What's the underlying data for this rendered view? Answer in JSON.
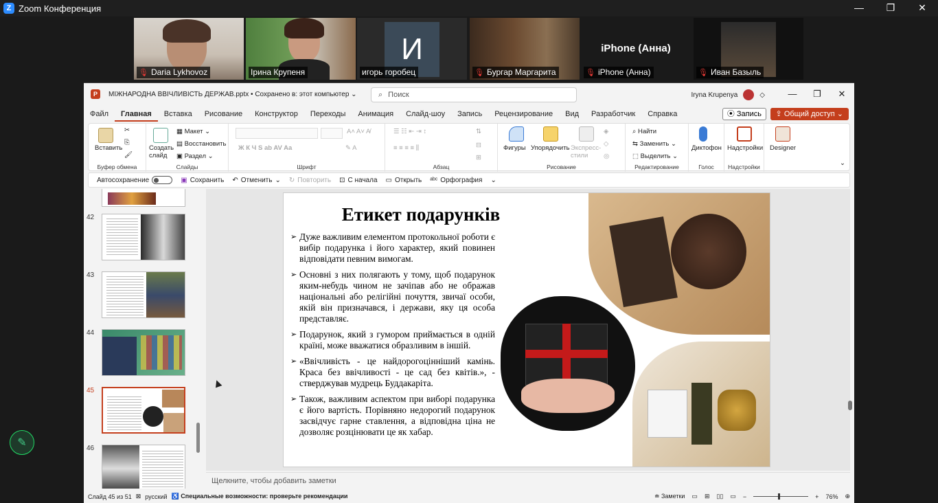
{
  "zoom": {
    "title": "Zoom Конференция",
    "window_buttons": [
      "—",
      "❐",
      "✕"
    ]
  },
  "participants": [
    {
      "name": "Daria Lykhovoz",
      "muted": true
    },
    {
      "name": "Ірина Крупеня",
      "muted": false,
      "active": true
    },
    {
      "name": "игорь горобец",
      "muted": false,
      "initial": "И"
    },
    {
      "name": "Бургар Маргарита",
      "muted": true
    },
    {
      "name": "iPhone (Анна)",
      "muted": true,
      "big_label": "iPhone (Анна)"
    },
    {
      "name": "Иван Базыль",
      "muted": true
    }
  ],
  "ppt": {
    "filename": "МІЖНАРОДНА ВВІЧЛИВІСТЬ ДЕРЖАВ.pptx • Сохранено в: этот компьютер ⌄",
    "search_placeholder": "Поиск",
    "user": "Iryna Krupenya",
    "menu": [
      "Файл",
      "Главная",
      "Вставка",
      "Рисование",
      "Конструктор",
      "Переходы",
      "Анимация",
      "Слайд-шоу",
      "Запись",
      "Рецензирование",
      "Вид",
      "Разработчик",
      "Справка"
    ],
    "record_label": "Запись",
    "share_label": "Общий доступ",
    "ribbon": {
      "clipboard": {
        "paste": "Вставить",
        "label": "Буфер обмена"
      },
      "slides": {
        "create": "Создать слайд",
        "layout": "Макет",
        "reset": "Восстановить",
        "section": "Раздел",
        "label": "Слайды"
      },
      "font": {
        "label": "Шрифт"
      },
      "paragraph": {
        "label": "Абзац"
      },
      "drawing": {
        "shapes": "Фигуры",
        "arrange": "Упорядочить",
        "quick_styles": "Экспресс-стили",
        "label": "Рисование"
      },
      "editing": {
        "find": "Найти",
        "replace": "Заменить",
        "select": "Выделить",
        "label": "Редактирование"
      },
      "voice": {
        "dictate": "Диктофон",
        "label": "Голос"
      },
      "addins": {
        "addins": "Надстройки",
        "label": "Надстройки"
      },
      "designer": "Designer"
    },
    "qat": {
      "autosave": "Автосохранение",
      "save": "Сохранить",
      "undo": "Отменить",
      "redo": "Повторить",
      "from_start": "С начала",
      "open": "Открыть",
      "spelling": "Орфография"
    },
    "thumbs": [
      "42",
      "43",
      "44",
      "45",
      "46"
    ],
    "selected_thumb": "45",
    "slide": {
      "title": "Етикет подарунків",
      "bullets": [
        "Дуже важливим елементом протокольної роботи є вибір подарунка і його характер, який повинен відповідати певним вимогам.",
        "Основні з них полягають у тому, щоб подарунок яким-небудь чином не зачіпав або не ображав національні або релігійні почуття, звичаї особи, якій він призначався, і держави, яку ця особа представляє.",
        "Подарунок, який з гумором приймається в одній країні, може вважатися образливим в іншій.",
        "«Ввічливість - це найдорогоцінніший камінь. Краса без ввічливості - це сад без квітів.», - стверджував мудрець Буддакаріта.",
        "Також, важливим аспектом при виборі подарунка є його вартість. Порівняно недорогий подарунок засвідчує гарне ставлення, а відповідна ціна не дозволяє розцінювати це як хабар."
      ]
    },
    "notes_placeholder": "Щелкните, чтобы добавить заметки",
    "status": {
      "slide_of": "Слайд 45 из 51",
      "language": "русский",
      "accessibility": "Специальные возможности: проверьте рекомендации",
      "notes": "Заметки",
      "zoom": "76%"
    }
  }
}
